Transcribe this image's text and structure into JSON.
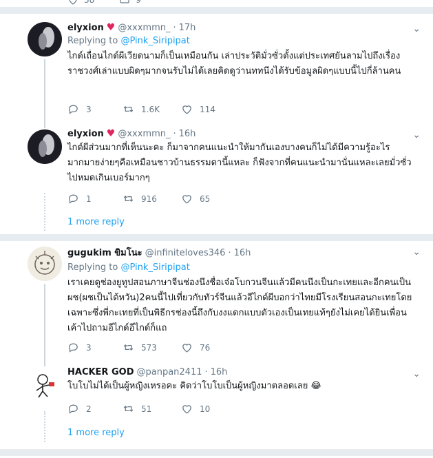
{
  "top_actions": {
    "likes": "38",
    "other": "9"
  },
  "tweets": [
    {
      "name": "elyxion",
      "handle": "@xxxmmn_",
      "time": "17h",
      "reply_prefix": "",
      "reply_to": "",
      "text": "ไกด์เถื่อนไกด์ผีเวียดนามก็เป็นเหมือนกัน เล่าประวัติมั่วซั่วตั้งแต่ประเทศยันลามไปถึงเรื่องราชวงศ์เล่าแบบผิดๆมากจนรับไม่ได้เลยคิดดูว่านททนึงได้รับข้อมูลผิดๆแบบนี้ไปกี่ล้านคน",
      "replies": "3",
      "retweets": "1.6K",
      "likes": "114"
    },
    {
      "name": "elyxion",
      "handle": "@xxxmmn_",
      "time": "16h",
      "reply_prefix": "",
      "reply_to": "",
      "text": "ไกด์ผีส่วนมากที่เห็นนะคะ ก็มาจากคนแนะนำให้มากันเองบางคนก็ไม่ได้มีความรู้อะไร มากมายง่ายๆคือเหมือนชาวบ้านธรรมดานี้แหละ ก็ฟังจากที่คนแนะนำมานั่นแหละเลยมั่วซั่วไปหมดเกินเบอร์มากๆ",
      "replies": "1",
      "retweets": "916",
      "likes": "65"
    },
    {
      "name": "gugukim ขิมโนะ",
      "handle": "@infiniteloves346",
      "time": "16h",
      "reply_prefix": "Replying to",
      "reply_to": "@Pink_Siripipat",
      "text": "เราเคยดูช่องยูทูปสอนภาษาจีนช่องนึงชื่อเจ๋อโบกวนจีนแล้วมีคนนึงเป็นกะเทยและอีกคนเป็นผช(ผชเป็นไต้หวัน)2คนนี้ไปเที่ยวกับทัวร์จีนแล้วอีไกด์ผีบอกว่าไทยมีโรงเรียนสอนกะเทยโดยเฉพาะซึ่งพี่กะเทยที่เป็นพิธีกรช่องนี้ถึงกับงงแดกแบบตัวเองเป็นเทยแท้ๆยังไม่เคยได้ยินเพื่อนเค้าไปถามอีไกด์อีไกด์ก็แถ",
      "replies": "3",
      "retweets": "573",
      "likes": "76"
    },
    {
      "name": "HACKER GOD",
      "handle": "@panpan2411",
      "time": "16h",
      "reply_prefix": "",
      "reply_to": "",
      "text": "โบโบไม่ได้เป็นผู้หญิงเหรอคะ คิดว่าโบโบเป็นผู้หญิงมาตลอดเลย 😂",
      "replies": "2",
      "retweets": "51",
      "likes": "10"
    }
  ],
  "replying_first": {
    "prefix": "Replying to",
    "target": "@Pink_Siripipat"
  },
  "more_reply_label": "1 more reply",
  "colors": {
    "accent": "#1da1f2",
    "muted": "#657786",
    "heart": "#e0245e"
  }
}
